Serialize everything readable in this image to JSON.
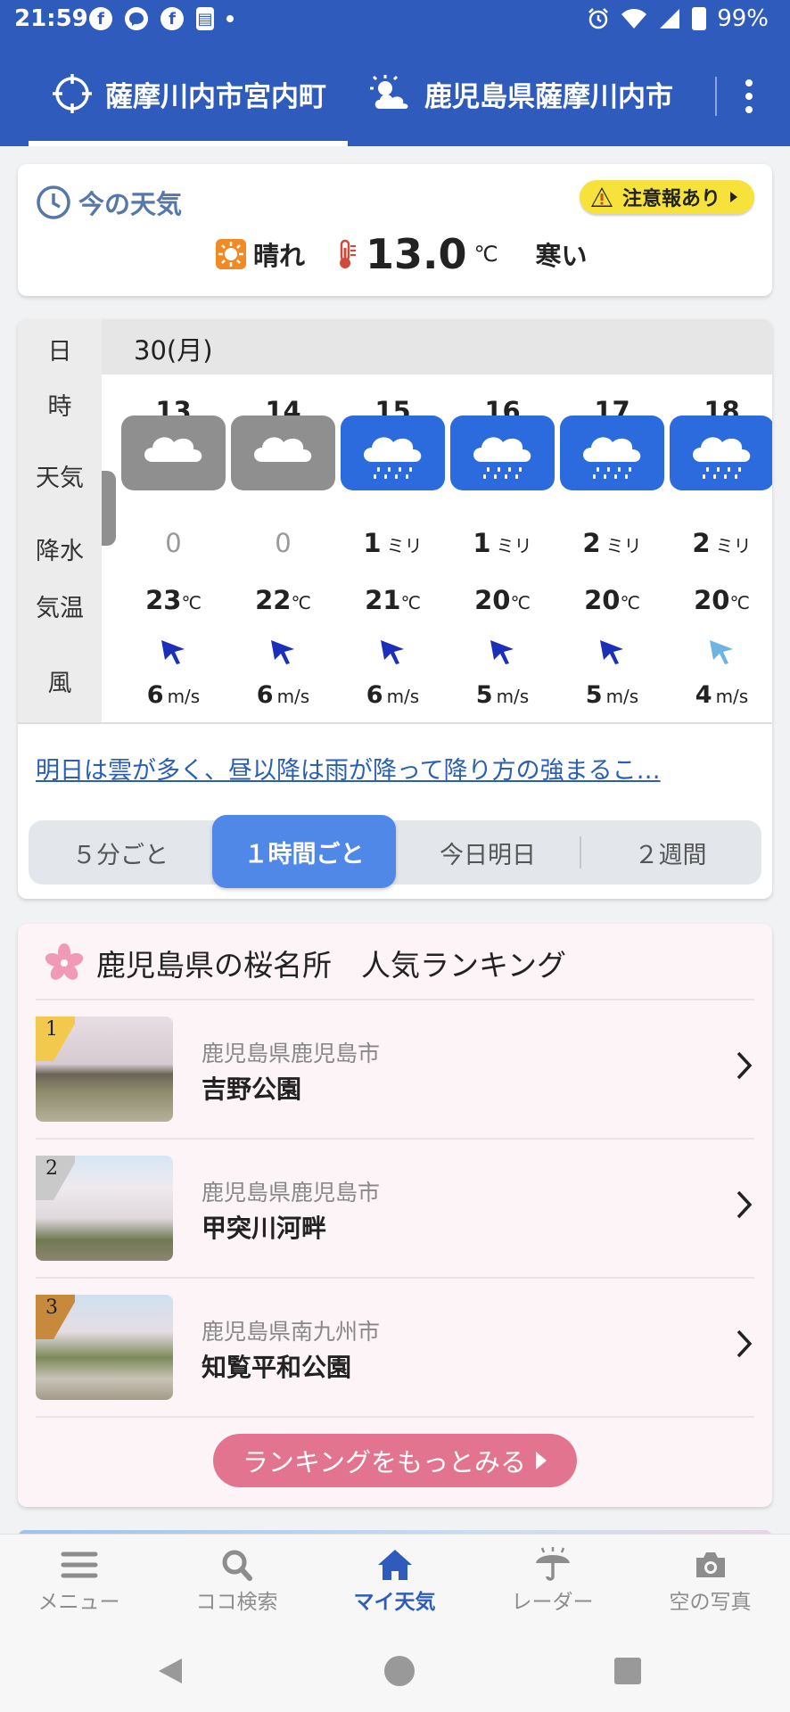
{
  "status_bar": {
    "time": "21:59",
    "battery": "99%",
    "notification_icons": [
      "facebook-icon",
      "messenger-icon",
      "facebook-icon",
      "sim-icon",
      "dot-icon"
    ],
    "system_icons": [
      "alarm-icon",
      "wifi-icon",
      "signal-icon",
      "battery-icon"
    ]
  },
  "header": {
    "tabs": [
      {
        "label": "薩摩川内市宮内町",
        "icon": "location-target-icon",
        "selected": true
      },
      {
        "label": "鹿児島県薩摩川内市",
        "icon": "sun-cloud-icon",
        "selected": false
      }
    ],
    "menu_icon": "more-vert-icon",
    "accent": "#2f5bbd"
  },
  "now": {
    "title": "今の天気",
    "title_icon": "clock-icon",
    "warning_badge": "注意報あり",
    "weather": "晴れ",
    "weather_icon": "sun-icon",
    "temp_value": "13.0",
    "temp_unit": "℃",
    "feel": "寒い"
  },
  "hourly": {
    "row_labels": {
      "day": "日",
      "hour": "時",
      "weather": "天気",
      "precip": "降水",
      "temp": "気温",
      "wind": "風"
    },
    "date": "30(月)",
    "precip_unit": "ミリ",
    "temp_unit": "℃",
    "wind_unit": "m/s",
    "hours": [
      {
        "hour": "13",
        "weather": "cloud",
        "precip": "0",
        "temp": "23",
        "wind": "6",
        "wind_strong": true
      },
      {
        "hour": "14",
        "weather": "cloud",
        "precip": "0",
        "temp": "22",
        "wind": "6",
        "wind_strong": true
      },
      {
        "hour": "15",
        "weather": "rain",
        "precip": "1",
        "temp": "21",
        "wind": "6",
        "wind_strong": true
      },
      {
        "hour": "16",
        "weather": "rain",
        "precip": "1",
        "temp": "20",
        "wind": "5",
        "wind_strong": true
      },
      {
        "hour": "17",
        "weather": "rain",
        "precip": "2",
        "temp": "20",
        "wind": "5",
        "wind_strong": true
      },
      {
        "hour": "18",
        "weather": "rain",
        "precip": "2",
        "temp": "20",
        "wind": "4",
        "wind_strong": false
      }
    ],
    "forecast_text": "明日は雲が多く、昼以降は雨が降って降り方の強まるこ…",
    "segments": [
      "５分ごと",
      "１時間ごと",
      "今日明日",
      "２週間"
    ],
    "active_segment": 1
  },
  "sakura": {
    "title": "鹿児島県の桜名所　人気ランキング",
    "title_icon": "sakura-icon",
    "items": [
      {
        "rank": "1",
        "region": "鹿児島県鹿児島市",
        "name": "吉野公園",
        "badge_color": "#f2c94c"
      },
      {
        "rank": "2",
        "region": "鹿児島県鹿児島市",
        "name": "甲突川河畔",
        "badge_color": "#c9c9c9"
      },
      {
        "rank": "3",
        "region": "鹿児島県南九州市",
        "name": "知覧平和公園",
        "badge_color": "#c7893c"
      }
    ],
    "more_button": "ランキングをもっとみる"
  },
  "bottom_nav": [
    {
      "label": "メニュー",
      "icon": "menu-icon",
      "active": false
    },
    {
      "label": "ココ検索",
      "icon": "search-icon",
      "active": false
    },
    {
      "label": "マイ天気",
      "icon": "home-icon",
      "active": true
    },
    {
      "label": "レーダー",
      "icon": "radar-umbrella-icon",
      "active": false
    },
    {
      "label": "空の写真",
      "icon": "camera-icon",
      "active": false
    }
  ],
  "system_nav": [
    "back-icon",
    "home-circle-icon",
    "recents-icon"
  ]
}
